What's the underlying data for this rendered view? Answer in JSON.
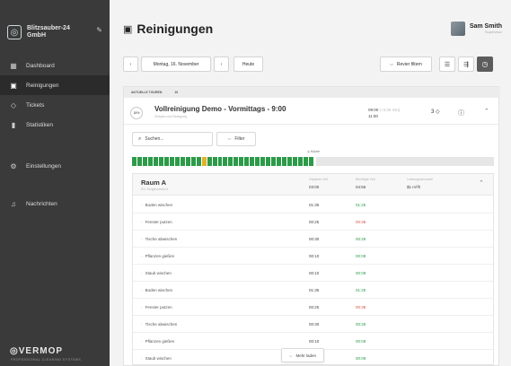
{
  "app": {
    "company": "Blitzsauber-24 GmbH",
    "brand_logo_text": "◎",
    "vermop": "VERMOP",
    "vermop_sub": "PROFESSIONAL CLEANING SYSTEMS"
  },
  "nav": {
    "items": [
      {
        "label": "Dashboard",
        "icon": "dashboard-icon",
        "glyph": "▦"
      },
      {
        "label": "Reinigungen",
        "icon": "calendar-icon",
        "glyph": "▣"
      },
      {
        "label": "Tickets",
        "icon": "ticket-icon",
        "glyph": "◇"
      },
      {
        "label": "Statistiken",
        "icon": "statistics-icon",
        "glyph": "▮"
      },
      {
        "label": "Einstellungen",
        "icon": "settings-icon",
        "glyph": "⚙"
      },
      {
        "label": "Nachrichten",
        "icon": "bell-icon",
        "glyph": "♫"
      }
    ]
  },
  "header": {
    "title": "Reinigungen",
    "title_glyph": "▣",
    "user_name": "Sam Smith",
    "user_role": "Supervisor"
  },
  "toolbar": {
    "prev": "‹",
    "date": "Montag, 16. November",
    "next": "›",
    "today": "Heute",
    "revier_filter": "Revier filtern",
    "chev": "⌵",
    "view_list": "☰",
    "view_tree": "⇶",
    "view_clock": "◷"
  },
  "tours": {
    "label": "AKTUELLE TOUREN",
    "count": "10"
  },
  "tour": {
    "progress": "18%",
    "name": "Vollreinigung Demo - Vormittags - 9:00",
    "sub": "Zeitplan und Reinigung",
    "time_start": "09:00",
    "time_range": "(+3:30 min)",
    "time_end": "11:00",
    "count": "3",
    "count_glyph": "◇",
    "info_glyph": "ⓘ",
    "chev": "⌃"
  },
  "search": {
    "placeholder": "Suchen...",
    "glyph": "⌕"
  },
  "filter": {
    "label": "Filter",
    "glyph": "⌵"
  },
  "progress_bar": {
    "marker": "Küche",
    "done_segments": 34,
    "highlight_index": 13
  },
  "room": {
    "name": "Raum A",
    "sub": "EG, Erdgeschoss A",
    "col_planned": "Geplante Zeit",
    "col_actual": "Benötigte Zeit",
    "col_perf": "Leistungskennzahl",
    "planned_total": "03:00",
    "actual_total": "04:55",
    "perf": "$1 m²/h",
    "chev": "⌃"
  },
  "tasks": [
    {
      "name": "Boden wischen",
      "planned": "01:35",
      "actual": "01:25",
      "status": "ok"
    },
    {
      "name": "Fenster putzen",
      "planned": "00:25",
      "actual": "00:38",
      "status": "late"
    },
    {
      "name": "Tische abwischen",
      "planned": "00:30",
      "actual": "00:28",
      "status": "ok"
    },
    {
      "name": "Pflanzen gießen",
      "planned": "00:10",
      "actual": "00:08",
      "status": "ok"
    },
    {
      "name": "Staub wischen",
      "planned": "00:10",
      "actual": "00:08",
      "status": "ok"
    },
    {
      "name": "Boden wischen",
      "planned": "01:35",
      "actual": "01:25",
      "status": "ok"
    },
    {
      "name": "Fenster putzen",
      "planned": "00:25",
      "actual": "00:38",
      "status": "late"
    },
    {
      "name": "Tische abwischen",
      "planned": "00:30",
      "actual": "00:28",
      "status": "ok"
    },
    {
      "name": "Pflanzen gießen",
      "planned": "00:10",
      "actual": "00:08",
      "status": "ok"
    },
    {
      "name": "Staub wischen",
      "planned": "",
      "actual": "00:08",
      "status": "ok"
    }
  ],
  "more": {
    "label": "Mehr laden",
    "glyph": "⌵"
  },
  "colors": {
    "ok": "#2d9a4a",
    "late": "#d9534f",
    "sidebar": "#3a3a3a"
  }
}
